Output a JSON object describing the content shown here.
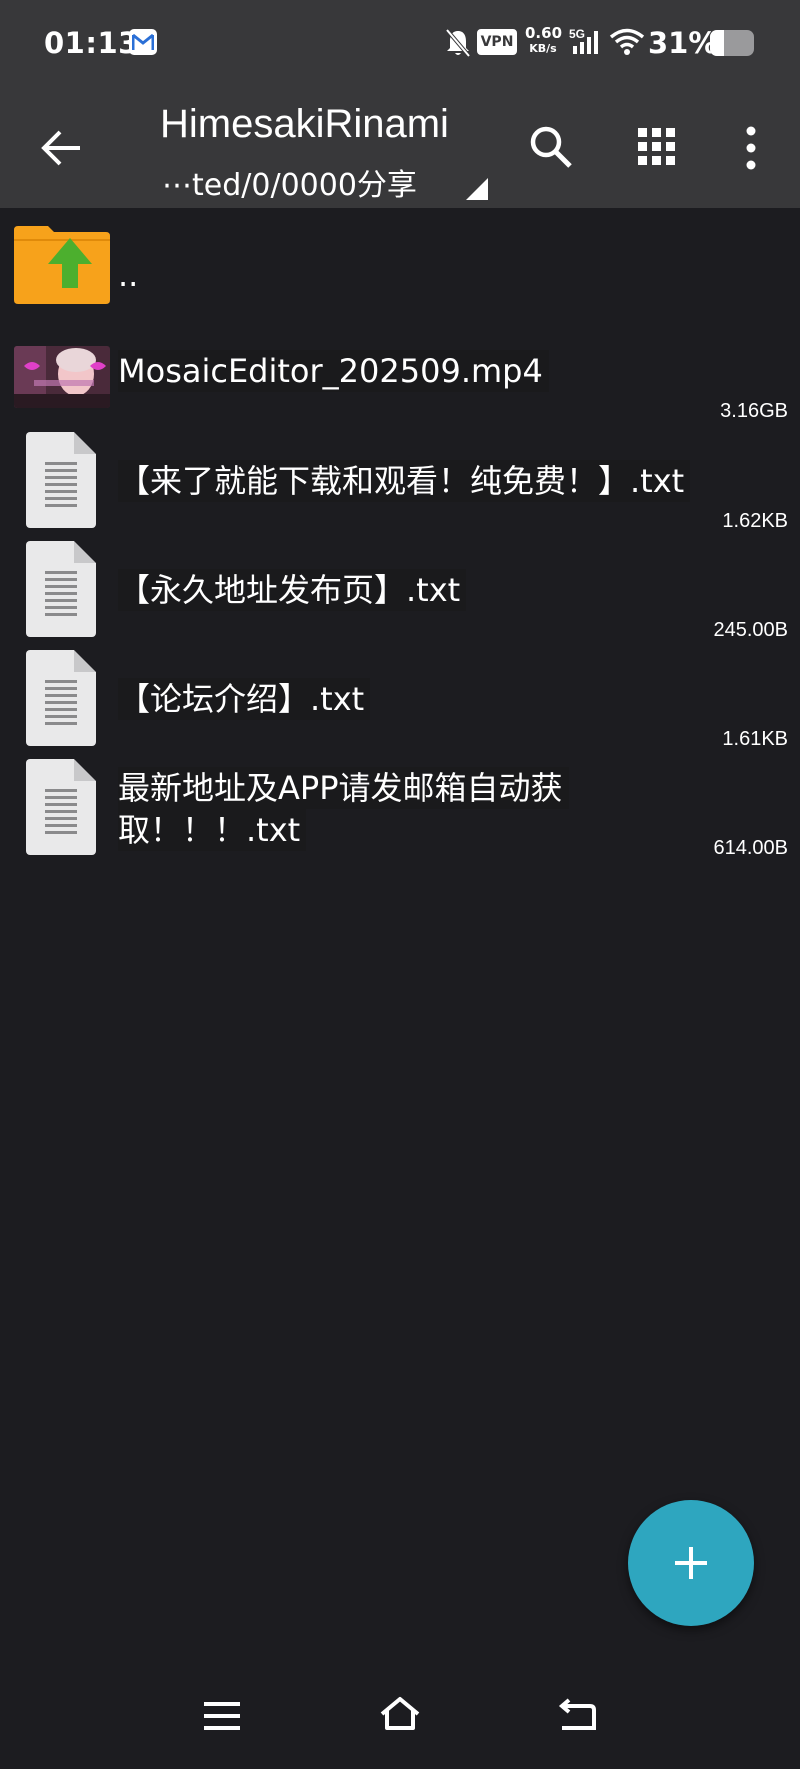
{
  "status_bar": {
    "time": "01:13",
    "vpn_label": "VPN",
    "speed_value": "0.60",
    "speed_unit": "KB/s",
    "network_label": "5G",
    "battery_text": "31%",
    "battery_level": 0.31
  },
  "app_bar": {
    "title": "HimesakiRinami",
    "path": "⋯ted/0/0000分享"
  },
  "files": [
    {
      "name": "..",
      "size": "",
      "icon": "parent-folder-icon"
    },
    {
      "name": "MosaicEditor_202509.mp4",
      "size": "3.16GB",
      "icon": "video-thumbnail"
    },
    {
      "name": "【来了就能下载和观看！纯免费！】.txt",
      "size": "1.62KB",
      "icon": "text-file-icon"
    },
    {
      "name": "【永久地址发布页】.txt",
      "size": "245.00B",
      "icon": "text-file-icon"
    },
    {
      "name": "【论坛介绍】.txt",
      "size": "1.61KB",
      "icon": "text-file-icon"
    },
    {
      "name_line1": "最新地址及APP请发邮箱自动获",
      "name_line2": "取！！！.txt",
      "size": "614.00B",
      "icon": "text-file-icon"
    }
  ],
  "colors": {
    "app_bar": "#38383a",
    "background": "#1c1c20",
    "fab": "#2ea6bf",
    "folder": "#f7a21b",
    "folder_arrow": "#4caf2e"
  }
}
